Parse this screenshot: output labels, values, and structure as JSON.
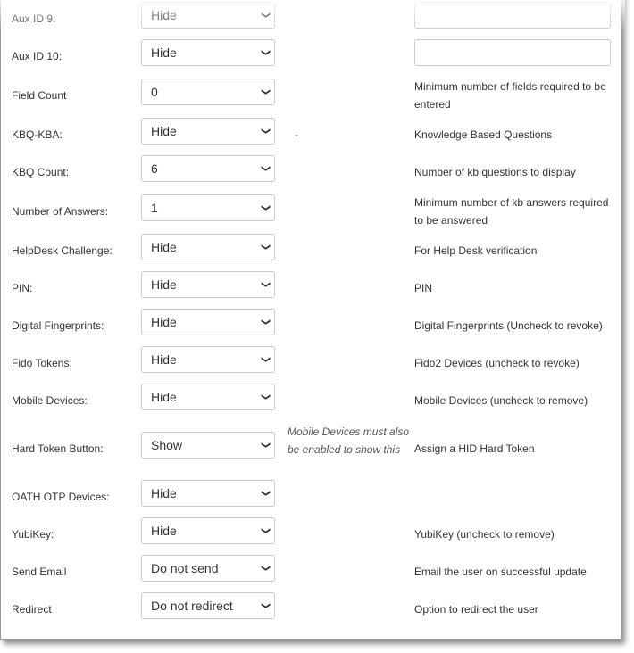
{
  "rows": [
    {
      "label": "Aux ID 9:",
      "value": "Hide",
      "note": "",
      "desc": "",
      "text_input": true
    },
    {
      "label": "Aux ID 10:",
      "value": "Hide",
      "note": "",
      "desc": "",
      "text_input": true
    },
    {
      "label": "Field Count",
      "value": "0",
      "note": "",
      "desc": "Minimum number of fields required to be entered"
    },
    {
      "label": "KBQ-KBA:",
      "value": "Hide",
      "note": "-",
      "desc": "Knowledge Based Questions"
    },
    {
      "label": "KBQ Count:",
      "value": "6",
      "note": "",
      "desc": "Number of kb questions to display"
    },
    {
      "label": "Number of Answers:",
      "value": "1",
      "note": "",
      "desc": "Minimum number of kb answers required to be answered"
    },
    {
      "label": "HelpDesk Challenge:",
      "value": "Hide",
      "note": "",
      "desc": "For Help Desk verification"
    },
    {
      "label": "PIN:",
      "value": "Hide",
      "note": "",
      "desc": "PIN"
    },
    {
      "label": "Digital Fingerprints:",
      "value": "Hide",
      "note": "",
      "desc": "Digital Fingerprints (Uncheck to revoke)"
    },
    {
      "label": "Fido Tokens:",
      "value": "Hide",
      "note": "",
      "desc": "Fido2 Devices (uncheck to revoke)"
    },
    {
      "label": "Mobile Devices:",
      "value": "Hide",
      "note": "",
      "desc": "Mobile Devices (uncheck to remove)"
    },
    {
      "label": "Hard Token Button:",
      "value": "Show",
      "note": "Mobile Devices must also be enabled to show this",
      "desc": "Assign a HID Hard Token"
    },
    {
      "label": "OATH OTP Devices:",
      "value": "Hide",
      "note": "",
      "desc": ""
    },
    {
      "label": "YubiKey:",
      "value": "Hide",
      "note": "",
      "desc": "YubiKey (uncheck to remove)"
    },
    {
      "label": "Send Email",
      "value": "Do not send",
      "note": "",
      "desc": "Email the user on successful update"
    },
    {
      "label": "Redirect",
      "value": "Do not redirect",
      "note": "",
      "desc": "Option to redirect the user"
    }
  ]
}
